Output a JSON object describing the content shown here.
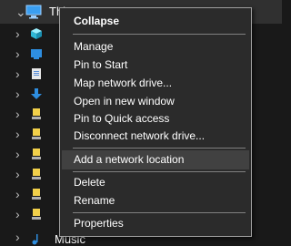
{
  "tree": {
    "top_item_label": "This PC",
    "bottom_item_label": "Music"
  },
  "context_menu": {
    "items": [
      {
        "label": "Collapse"
      },
      {
        "label": "Manage"
      },
      {
        "label": "Pin to Start"
      },
      {
        "label": "Map network drive..."
      },
      {
        "label": "Open in new window"
      },
      {
        "label": "Pin to Quick access"
      },
      {
        "label": "Disconnect network drive..."
      },
      {
        "label": "Add a network location"
      },
      {
        "label": "Delete"
      },
      {
        "label": "Rename"
      },
      {
        "label": "Properties"
      }
    ]
  }
}
